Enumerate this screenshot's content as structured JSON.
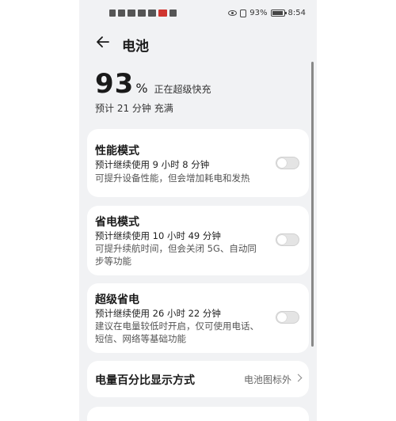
{
  "status_bar": {
    "battery_percent_text": "93%",
    "time": "8:54",
    "icons": [
      "nfc-icon",
      "sim-icon",
      "signal-icon",
      "wifi-icon",
      "wechat-icon",
      "app-icon",
      "app-icon",
      "eye-icon",
      "vibrate-icon",
      "battery-icon"
    ]
  },
  "header": {
    "title": "电池",
    "back_icon": "arrow-left-icon"
  },
  "battery": {
    "level": "93",
    "unit": "%",
    "status": "正在超级快充",
    "eta": "预计 21 分钟 充满"
  },
  "modes": [
    {
      "title": "性能模式",
      "duration": "预计继续使用 9 小时 8 分钟",
      "description": "可提升设备性能，但会增加耗电和发热",
      "enabled": false
    },
    {
      "title": "省电模式",
      "duration": "预计继续使用 10 小时 49 分钟",
      "description": "可提升续航时间，但会关闭 5G、自动同步等功能",
      "enabled": false
    },
    {
      "title": "超级省电",
      "duration": "预计继续使用 26 小时 22 分钟",
      "description": "建议在电量较低时开启，仅可使用电话、短信、网络等基础功能",
      "enabled": false
    }
  ],
  "percent_display": {
    "label": "电量百分比显示方式",
    "value": "电池图标外"
  },
  "colors": {
    "background": "#f1f2f4",
    "card": "#ffffff",
    "toggle_off": "#e4e4e4"
  }
}
